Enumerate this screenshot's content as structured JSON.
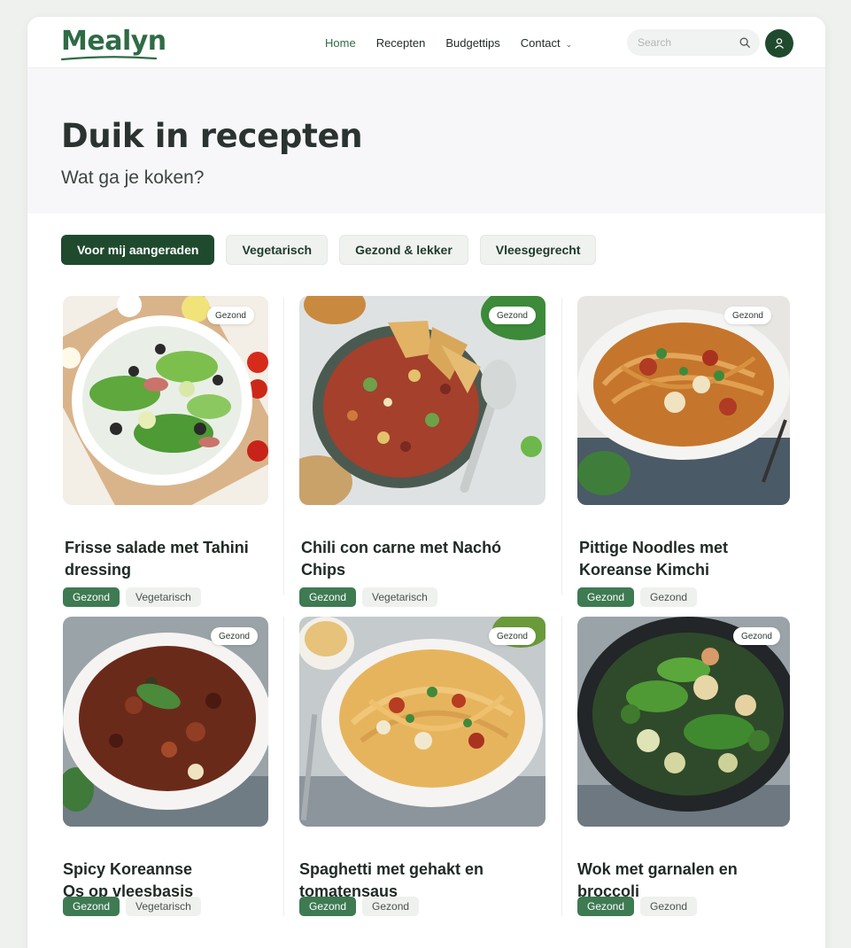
{
  "brand": {
    "name": "Mealyn"
  },
  "nav": {
    "links": [
      {
        "label": "Home",
        "active": true
      },
      {
        "label": "Recepten"
      },
      {
        "label": "Budgettips"
      },
      {
        "label": "Contact"
      }
    ],
    "search_placeholder": "Search"
  },
  "hero": {
    "title": "Duik in recepten",
    "subtitle": "Wat ga je koken?"
  },
  "filters": [
    {
      "label": "Voor mij aangeraden",
      "active": true
    },
    {
      "label": "Vegetarisch"
    },
    {
      "label": "Gezond & lekker"
    },
    {
      "label": "Vleesgegrecht"
    }
  ],
  "recipes": [
    {
      "title_1": "Frisse salade met Tahini",
      "title_2": "dressing",
      "badge": "Gezond",
      "tags": [
        "Gezond",
        "Vegetarisch"
      ]
    },
    {
      "title_1": "Chili con carne met Nachó",
      "title_2": "Chips",
      "badge": "Gezond",
      "tags": [
        "Gezond",
        "Vegetarisch"
      ]
    },
    {
      "title_1": "Pittige Noodles met",
      "title_2": "Koreanse Kimchi",
      "badge": "Gezond",
      "tags": [
        "Gezond",
        "Gezond"
      ]
    },
    {
      "title_1": "Spicy Koreannse",
      "title_2": "Os op vleesbasis",
      "badge": "Gezond",
      "tags": [
        "Gezond",
        "Vegetarisch"
      ]
    },
    {
      "title_1": "Spaghetti met gehakt en",
      "title_2": "tomatensaus",
      "badge": "Gezond",
      "tags": [
        "Gezond",
        "Gezond"
      ]
    },
    {
      "title_1": "Wok met garnalen en",
      "title_2": "broccoli",
      "badge": "Gezond",
      "tags": [
        "Gezond",
        "Gezond"
      ]
    }
  ],
  "colors": {
    "brand_green": "#2f6b45",
    "dark_green": "#1f4a2e",
    "tag_green": "#3e7a52"
  },
  "icons": {
    "search": "search-icon",
    "user": "user-icon",
    "caret": "chevron-down-icon"
  }
}
